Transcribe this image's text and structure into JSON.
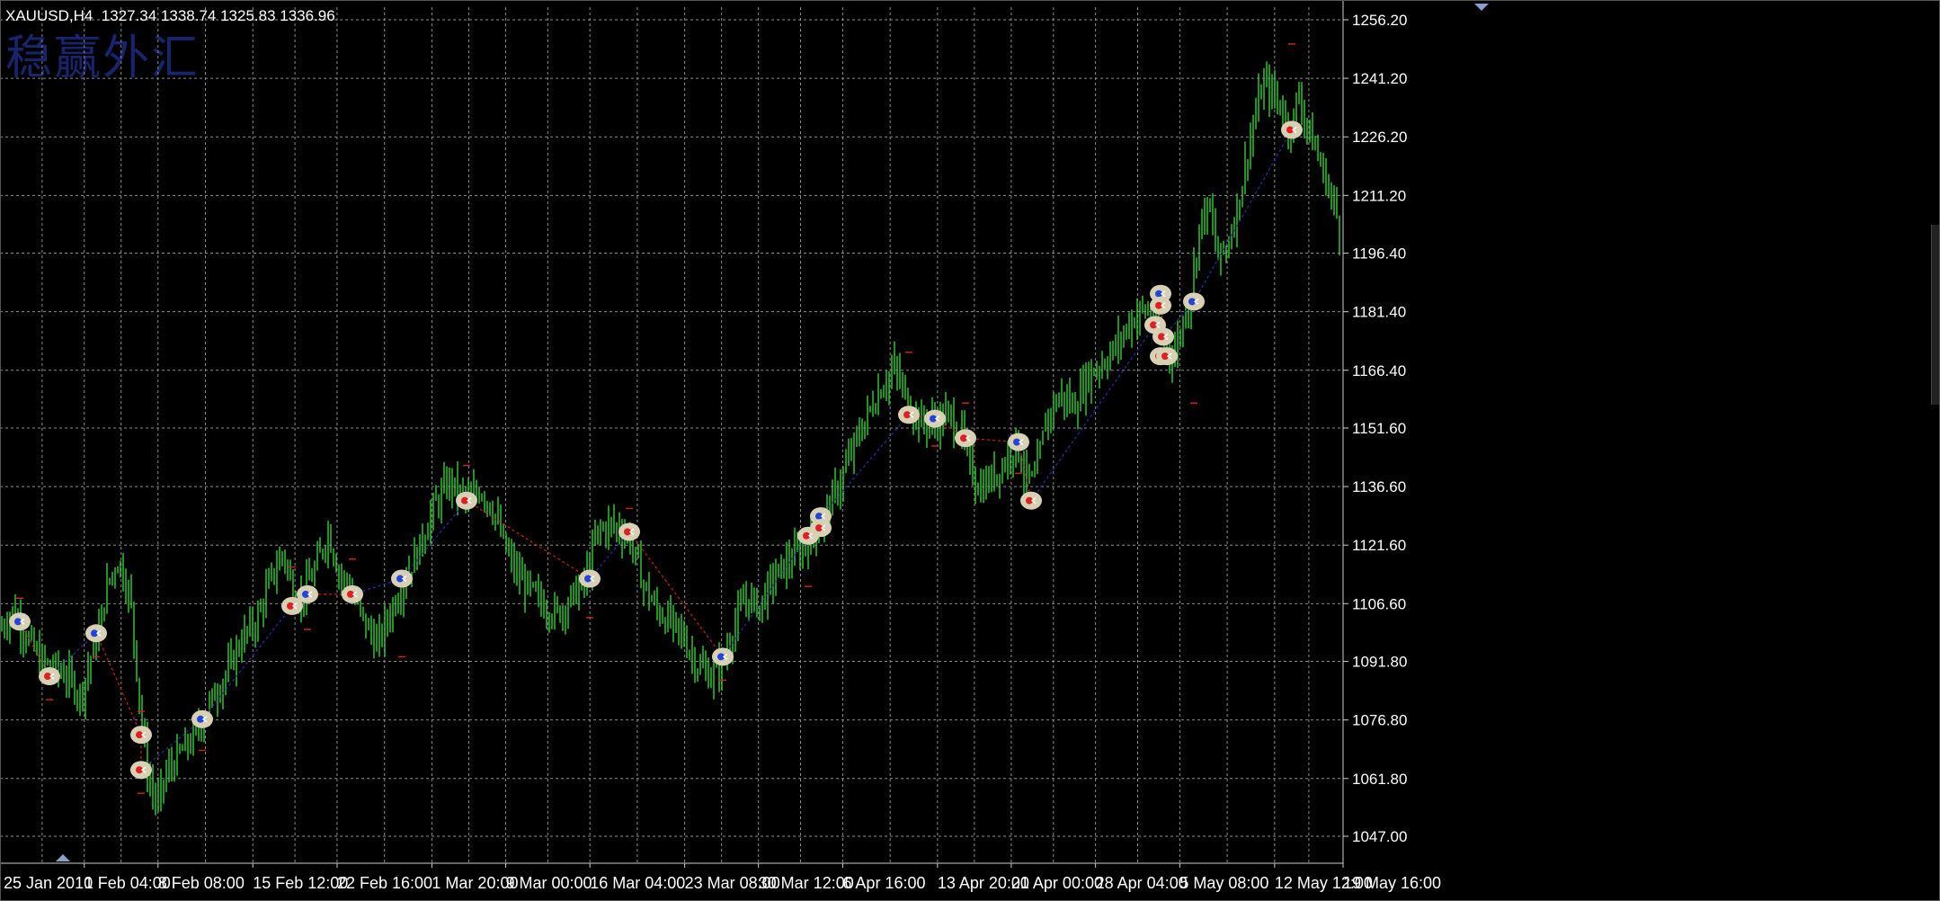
{
  "header": {
    "symbol_info": "XAUUSD,H4  1327.34 1338.74 1325.83 1336.96",
    "watermark": "稳赢外汇"
  },
  "colors": {
    "background": "#000000",
    "grid": "#8c8c8c",
    "candle": "#2fd42f",
    "axis_text": "#ffffff",
    "zigzag_up": "#2233aa",
    "zigzag_down": "#cc1f1f",
    "marker_fill": "#d8d0b4",
    "marker_red": "#e02020",
    "marker_blue": "#2244dd",
    "watermark": "#1b2a78"
  },
  "chart_data": {
    "type": "candlestick",
    "title": "XAUUSD,H4",
    "ohlc_last": {
      "open": 1327.34,
      "high": 1338.74,
      "low": 1325.83,
      "close": 1336.96
    },
    "ylim": [
      1040.0,
      1260.0
    ],
    "y_ticks": [
      "1256.20",
      "1241.20",
      "1226.20",
      "1211.20",
      "1196.40",
      "1181.40",
      "1166.40",
      "1151.60",
      "1136.60",
      "1121.60",
      "1106.60",
      "1091.80",
      "1076.80",
      "1061.80",
      "1047.00"
    ],
    "x_ticks": [
      "25 Jan 2010",
      "1 Feb 04:00",
      "8 Feb 08:00",
      "15 Feb 12:00",
      "22 Feb 16:00",
      "1 Mar 20:00",
      "9 Mar 00:00",
      "16 Mar 04:00",
      "23 Mar 08:00",
      "30 Mar 12:00",
      "6 Apr 16:00",
      "13 Apr 20:00",
      "21 Apr 00:00",
      "28 Apr 04:00",
      "5 May 08:00",
      "12 May 12:00",
      "19 May 16:00"
    ],
    "price_path": [
      [
        0,
        1100
      ],
      [
        15,
        1105
      ],
      [
        30,
        1098
      ],
      [
        45,
        1092
      ],
      [
        60,
        1090
      ],
      [
        75,
        1088
      ],
      [
        90,
        1083
      ],
      [
        100,
        1092
      ],
      [
        110,
        1100
      ],
      [
        120,
        1112
      ],
      [
        132,
        1118
      ],
      [
        145,
        1108
      ],
      [
        152,
        1090
      ],
      [
        158,
        1075
      ],
      [
        165,
        1062
      ],
      [
        175,
        1055
      ],
      [
        185,
        1063
      ],
      [
        200,
        1068
      ],
      [
        215,
        1072
      ],
      [
        228,
        1078
      ],
      [
        240,
        1084
      ],
      [
        255,
        1090
      ],
      [
        270,
        1098
      ],
      [
        285,
        1102
      ],
      [
        300,
        1112
      ],
      [
        315,
        1120
      ],
      [
        325,
        1110
      ],
      [
        335,
        1108
      ],
      [
        350,
        1115
      ],
      [
        365,
        1125
      ],
      [
        378,
        1114
      ],
      [
        390,
        1110
      ],
      [
        405,
        1102
      ],
      [
        420,
        1096
      ],
      [
        435,
        1105
      ],
      [
        450,
        1113
      ],
      [
        465,
        1120
      ],
      [
        480,
        1130
      ],
      [
        500,
        1138
      ],
      [
        510,
        1135
      ],
      [
        520,
        1133
      ],
      [
        535,
        1136
      ],
      [
        550,
        1130
      ],
      [
        560,
        1122
      ],
      [
        575,
        1114
      ],
      [
        590,
        1110
      ],
      [
        605,
        1106
      ],
      [
        620,
        1104
      ],
      [
        635,
        1108
      ],
      [
        650,
        1112
      ],
      [
        665,
        1125
      ],
      [
        680,
        1127
      ],
      [
        700,
        1124
      ],
      [
        715,
        1112
      ],
      [
        730,
        1105
      ],
      [
        745,
        1102
      ],
      [
        760,
        1098
      ],
      [
        775,
        1091
      ],
      [
        790,
        1088
      ],
      [
        805,
        1092
      ],
      [
        815,
        1100
      ],
      [
        830,
        1108
      ],
      [
        845,
        1106
      ],
      [
        860,
        1113
      ],
      [
        875,
        1117
      ],
      [
        890,
        1120
      ],
      [
        905,
        1124
      ],
      [
        920,
        1130
      ],
      [
        935,
        1138
      ],
      [
        950,
        1147
      ],
      [
        965,
        1155
      ],
      [
        980,
        1162
      ],
      [
        995,
        1167
      ],
      [
        1010,
        1158
      ],
      [
        1025,
        1153
      ],
      [
        1040,
        1153
      ],
      [
        1055,
        1155
      ],
      [
        1070,
        1150
      ],
      [
        1080,
        1141
      ],
      [
        1090,
        1136
      ],
      [
        1100,
        1138
      ],
      [
        1115,
        1142
      ],
      [
        1130,
        1148
      ],
      [
        1140,
        1140
      ],
      [
        1150,
        1137
      ],
      [
        1165,
        1155
      ],
      [
        1180,
        1160
      ],
      [
        1195,
        1157
      ],
      [
        1210,
        1165
      ],
      [
        1225,
        1168
      ],
      [
        1240,
        1172
      ],
      [
        1255,
        1178
      ],
      [
        1270,
        1182
      ],
      [
        1285,
        1180
      ],
      [
        1295,
        1173
      ],
      [
        1305,
        1170
      ],
      [
        1315,
        1178
      ],
      [
        1325,
        1186
      ],
      [
        1335,
        1205
      ],
      [
        1345,
        1208
      ],
      [
        1355,
        1195
      ],
      [
        1365,
        1198
      ],
      [
        1380,
        1212
      ],
      [
        1390,
        1225
      ],
      [
        1405,
        1240
      ],
      [
        1420,
        1236
      ],
      [
        1435,
        1228
      ],
      [
        1445,
        1237
      ],
      [
        1455,
        1228
      ],
      [
        1465,
        1222
      ],
      [
        1475,
        1215
      ],
      [
        1485,
        1208
      ],
      [
        1494,
        1198
      ]
    ],
    "zigzag": [
      [
        22,
        1102
      ],
      [
        55,
        1088
      ],
      [
        107,
        1099
      ],
      [
        157,
        1073
      ],
      [
        157,
        1064
      ],
      [
        225,
        1077
      ],
      [
        325,
        1106
      ],
      [
        342,
        1109
      ],
      [
        392,
        1109
      ],
      [
        447,
        1113
      ],
      [
        519,
        1133
      ],
      [
        656,
        1113
      ],
      [
        700,
        1125
      ],
      [
        804,
        1093
      ],
      [
        899,
        1124
      ],
      [
        913,
        1129
      ],
      [
        1011,
        1155
      ],
      [
        1040,
        1154
      ],
      [
        1074,
        1149
      ],
      [
        1133,
        1148
      ],
      [
        1147,
        1133
      ],
      [
        1285,
        1178
      ],
      [
        1291,
        1186
      ],
      [
        1294,
        1175
      ],
      [
        1328,
        1184
      ],
      [
        1437,
        1228
      ]
    ],
    "signals": [
      {
        "x": 22,
        "y": 1102,
        "dir": "buy"
      },
      {
        "x": 55,
        "y": 1088,
        "dir": "sell"
      },
      {
        "x": 107,
        "y": 1099,
        "dir": "buy"
      },
      {
        "x": 157,
        "y": 1073,
        "dir": "sell"
      },
      {
        "x": 157,
        "y": 1064,
        "dir": "sell"
      },
      {
        "x": 225,
        "y": 1077,
        "dir": "buy"
      },
      {
        "x": 325,
        "y": 1106,
        "dir": "sell"
      },
      {
        "x": 342,
        "y": 1109,
        "dir": "buy"
      },
      {
        "x": 392,
        "y": 1109,
        "dir": "sell"
      },
      {
        "x": 447,
        "y": 1113,
        "dir": "buy"
      },
      {
        "x": 519,
        "y": 1133,
        "dir": "sell"
      },
      {
        "x": 656,
        "y": 1113,
        "dir": "buy"
      },
      {
        "x": 700,
        "y": 1125,
        "dir": "sell"
      },
      {
        "x": 804,
        "y": 1093,
        "dir": "buy"
      },
      {
        "x": 899,
        "y": 1124,
        "dir": "sell"
      },
      {
        "x": 913,
        "y": 1129,
        "dir": "buy"
      },
      {
        "x": 913,
        "y": 1126,
        "dir": "sell"
      },
      {
        "x": 1011,
        "y": 1155,
        "dir": "sell"
      },
      {
        "x": 1040,
        "y": 1154,
        "dir": "buy"
      },
      {
        "x": 1074,
        "y": 1149,
        "dir": "sell"
      },
      {
        "x": 1133,
        "y": 1148,
        "dir": "buy"
      },
      {
        "x": 1147,
        "y": 1133,
        "dir": "sell"
      },
      {
        "x": 1285,
        "y": 1178,
        "dir": "sell"
      },
      {
        "x": 1291,
        "y": 1186,
        "dir": "buy"
      },
      {
        "x": 1291,
        "y": 1183,
        "dir": "sell"
      },
      {
        "x": 1294,
        "y": 1175,
        "dir": "sell"
      },
      {
        "x": 1291,
        "y": 1170,
        "dir": "sell"
      },
      {
        "x": 1298,
        "y": 1170,
        "dir": "sell"
      },
      {
        "x": 1328,
        "y": 1184,
        "dir": "buy"
      },
      {
        "x": 1437,
        "y": 1228,
        "dir": "sell"
      }
    ],
    "grid": true
  }
}
